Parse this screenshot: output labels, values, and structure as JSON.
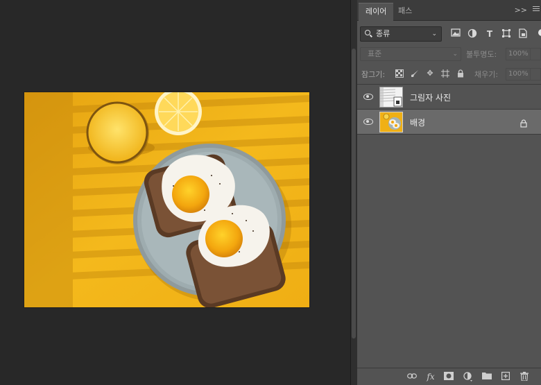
{
  "panel": {
    "tabs": [
      "레이어",
      "패스"
    ],
    "collapse_label": ">>",
    "filter": {
      "label": "종류",
      "icons": [
        "image-filter-icon",
        "adjustment-filter-icon",
        "type-filter-icon",
        "shape-filter-icon",
        "smart-object-filter-icon",
        "filter-toggle-icon"
      ]
    },
    "blend_mode": "표준",
    "opacity_label": "불투명도:",
    "opacity_value": "100%",
    "lock_label": "잠그기:",
    "fill_label": "채우기:",
    "fill_value": "100%",
    "layers": [
      {
        "name": "그림자 사진",
        "visible": true,
        "selected": false,
        "locked": false
      },
      {
        "name": "배경",
        "visible": true,
        "selected": true,
        "locked": true
      }
    ],
    "bottom_icons": [
      "link-icon",
      "fx-icon",
      "mask-icon",
      "adjustment-icon",
      "folder-icon",
      "new-layer-icon",
      "trash-icon"
    ]
  },
  "colors": {
    "panel": "#535353",
    "canvas_bg": "#282828",
    "selected_layer": "#6a6a6a",
    "photo_yellow": "#f2b21a"
  }
}
